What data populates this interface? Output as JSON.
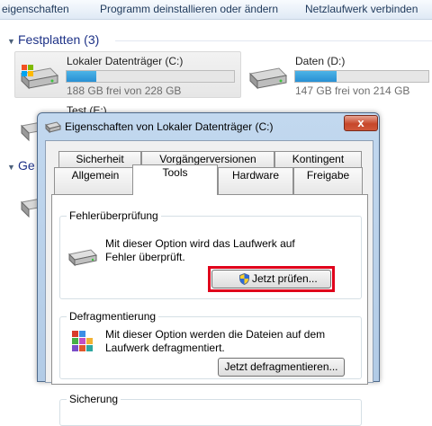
{
  "toolbar": {
    "item1": "eigenschaften",
    "item2": "Programm deinstallieren oder ändern",
    "item3": "Netzlaufwerk verbinden"
  },
  "explorer": {
    "group_hdd": "Festplatten (3)",
    "group_other_partial": "Ge",
    "drives": [
      {
        "name": "Lokaler Datenträger (C:)",
        "free_text": "188 GB frei von 228 GB",
        "used_fraction": 0.18
      },
      {
        "name": "Daten (D:)",
        "free_text": "147 GB frei von 214 GB",
        "used_fraction": 0.31
      },
      {
        "name": "Test (E:)"
      }
    ]
  },
  "dialog": {
    "title": "Eigenschaften von Lokaler Datenträger (C:)",
    "close_label": "x",
    "tabs_row1": [
      "Sicherheit",
      "Vorgängerversionen",
      "Kontingent"
    ],
    "tabs_row2": [
      "Allgemein",
      "Tools",
      "Hardware",
      "Freigabe"
    ],
    "active_tab": "Tools",
    "error_check": {
      "label": "Fehlerüberprüfung",
      "text_line1": "Mit dieser Option wird das Laufwerk auf",
      "text_line2": "Fehler überprüft.",
      "button": "Jetzt prüfen..."
    },
    "defrag": {
      "label": "Defragmentierung",
      "text_line1": "Mit dieser Option werden die Dateien auf dem",
      "text_line2": "Laufwerk defragmentiert.",
      "button": "Jetzt defragmentieren..."
    },
    "backup": {
      "label": "Sicherung"
    }
  },
  "colors": {
    "highlight": "#e0001b",
    "bar_fill": "#2890d4",
    "header_blue": "#1e3287"
  }
}
